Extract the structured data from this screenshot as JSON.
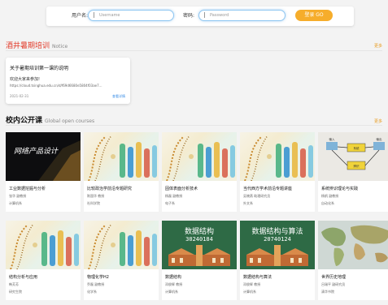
{
  "login": {
    "username_label": "用户名:",
    "username_placeholder": "Username",
    "password_label": "密码:",
    "password_placeholder": "Password",
    "login_button": "登录 GO"
  },
  "notice": {
    "title": "酒井暑期培训",
    "subtitle": "Notice",
    "more": "更多",
    "card": {
      "title": "关于暑期培训第一课的说明",
      "body": "欢迎大家来参加!",
      "url": "https://cloud.tsinghua.edu.cn/d/f69d6680e5804f03ae7...",
      "date": "2021-02-31",
      "detail": "查看详情"
    }
  },
  "courses": {
    "title": "校内公开课",
    "subtitle": "Global open courses",
    "more": "更多",
    "items": [
      {
        "title": "工业数据挖掘与分析",
        "teacher": "张华 副教授",
        "school": "计算机系",
        "thumb": "dark",
        "thumb_text": "网络产品设计"
      },
      {
        "title": "比较政治学前沿专题研究",
        "teacher": "陈国华 教授",
        "school": "社科学院",
        "thumb": "lab",
        "thumb_text": ""
      },
      {
        "title": "固体表面分析技术",
        "teacher": "杨磊 副教授",
        "school": "电子系",
        "thumb": "lab",
        "thumb_text": ""
      },
      {
        "title": "当代西方学术前沿专题讲座",
        "teacher": "吴晓燕 助理研究员",
        "school": "外文系",
        "thumb": "lab",
        "thumb_text": ""
      },
      {
        "title": "系统辨识理论与实践",
        "teacher": "杨帆 副教授",
        "school": "自动化系",
        "thumb": "sketch",
        "thumb_text": ""
      },
      {
        "title": "结构分析与应用",
        "teacher": "韩芳芳",
        "school": "研究生院",
        "thumb": "lab",
        "thumb_text": ""
      },
      {
        "title": "物理化学H2",
        "teacher": "乔磊 副教授",
        "school": "化学系",
        "thumb": "lab",
        "thumb_text": ""
      },
      {
        "title": "数据结构",
        "teacher": "邓俊辉 教授",
        "school": "计算机系",
        "thumb": "green",
        "thumb_text": "数据结构",
        "thumb_code": "30240184"
      },
      {
        "title": "数据结构与算法",
        "teacher": "邓俊辉 教授",
        "school": "计算机系",
        "thumb": "green",
        "thumb_text": "数据结构与算法",
        "thumb_code": "20740124"
      },
      {
        "title": "世界历史地理",
        "teacher": "吕瑞平 副研究员",
        "school": "清华书院",
        "thumb": "map",
        "thumb_text": ""
      }
    ]
  },
  "sketch_labels": [
    "输入",
    "系统",
    "输出",
    "辨识"
  ],
  "colors": {
    "accent": "#f6ad2b",
    "notice_red": "#e23b2a",
    "link": "#3a8ee6"
  }
}
